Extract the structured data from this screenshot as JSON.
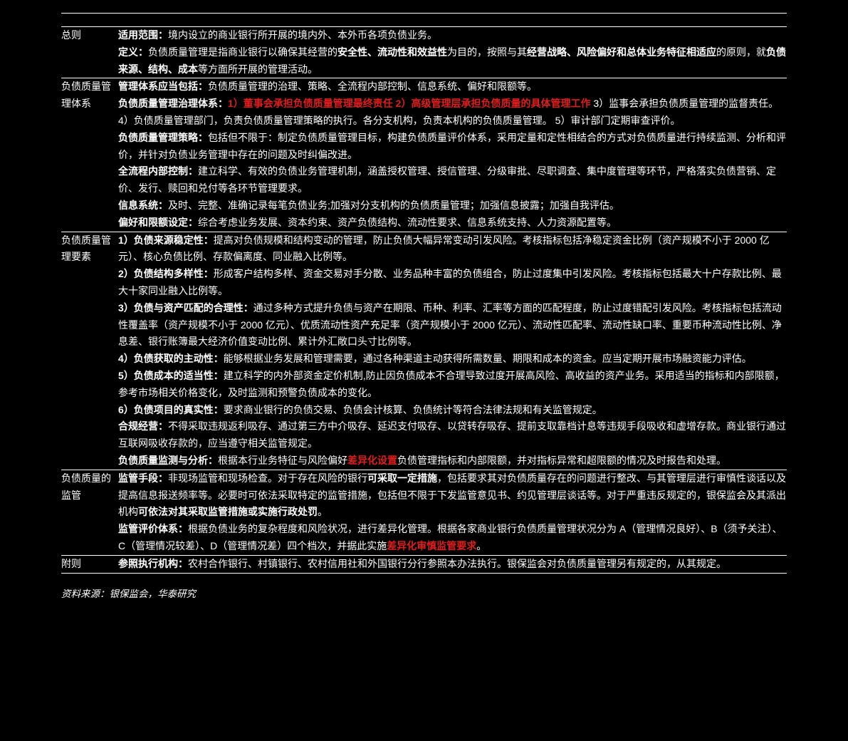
{
  "sections": {
    "general": {
      "label": "总则",
      "scope_prefix_b": "适用范围：",
      "scope_rest": "境内设立的商业银行所开展的境内外、本外币各项负债业务。",
      "def_prefix_b": "定义：",
      "def_p1": "负债质量管理是指商业银行以确保其经营的",
      "def_b1": "安全性、流动性和效益性",
      "def_p2": "为目的，按照与其",
      "def_b2": "经营战略、风险偏好和总体业务特征相适应",
      "def_p3": "的原则，就",
      "def_b3": "负债来源、结构、成本",
      "def_p4": "等方面所开展的管理活动。"
    },
    "system": {
      "label": "负债质量管理体系",
      "t_b": "管理体系应当包括：",
      "t_rest": "负债质量管理的治理、策略、全流程内部控制、信息系统、偏好和限额等。",
      "g_b": "负债质量管理治理体系：",
      "g_red": "1）董事会承担负债质量管理最终责任   2）高级管理层承担负债质量的具体管理工作",
      "g_tail": "  3）监事会承担负债质量管理的监督责任。 4）负债质量管理部门，负责负债质量管理策略的执行。各分支机构，负责本机构的负债质量管理。 5）审计部门定期审查评价。",
      "s_b": "负债质量管理策略：",
      "s_rest": "包括但不限于：制定负债质量管理目标，构建负债质量评价体系，采用定量和定性相结合的方式对负债质量进行持续监测、分析和评价，并针对负债业务管理中存在的问题及时纠偏改进。",
      "ic_b": "全流程内部控制：",
      "ic_rest": "建立科学、有效的负债业务管理机制，涵盖授权管理、授信管理、分级审批、尽职调查、集中度管理等环节，严格落实负债营销、定价、发行、赎回和兑付等各环节管理要求。",
      "is_b": "信息系统：",
      "is_rest": "及时、完整、准确记录每笔负债业务;加强对分支机构的负债质量管理；加强信息披露；加强自我评估。",
      "pl_b": "偏好和限额设定：",
      "pl_rest": "综合考虑业务发展、资本约束、资产负债结构、流动性要求、信息系统支持、人力资源配置等。"
    },
    "elements": {
      "label": "负债质量管理要素",
      "e1_b": "1）负债来源稳定性：",
      "e1_rest": "提高对负债规模和结构变动的管理，防止负债大幅异常变动引发风险。考核指标包括净稳定资金比例（资产规模不小于 2000 亿元）、核心负债比例、存款偏离度、同业融入比例等。",
      "e2_b": "2）负债结构多样性：",
      "e2_rest": "形成客户结构多样、资金交易对手分散、业务品种丰富的负债组合，防止过度集中引发风险。考核指标包括最大十户存款比例、最大十家同业融入比例等。",
      "e3_b": "3）负债与资产匹配的合理性：",
      "e3_rest": "通过多种方式提升负债与资产在期限、币种、利率、汇率等方面的匹配程度，防止过度错配引发风险。考核指标包括流动性覆盖率（资产规模不小于 2000 亿元）、优质流动性资产充足率（资产规模小于 2000 亿元）、流动性匹配率、流动性缺口率、重要币种流动性比例、净息差、银行账簿最大经济价值变动比例、累计外汇敞口头寸比例等。",
      "e4_b": "4）负债获取的主动性：",
      "e4_rest": "能够根据业务发展和管理需要，通过各种渠道主动获得所需数量、期限和成本的资金。应当定期开展市场融资能力评估。",
      "e5_b": "5）负债成本的适当性：",
      "e5_rest": "建立科学的内外部资金定价机制,防止因负债成本不合理导致过度开展高风险、高收益的资产业务。采用适当的指标和内部限额，参考市场相关价格变化，及时监测和预警负债成本的变化。",
      "e6_b": "6）负债项目的真实性：",
      "e6_rest": "要求商业银行的负债交易、负债会计核算、负债统计等符合法律法规和有关监管规定。",
      "c_b": "合规经营：",
      "c_rest": "不得采取违规返利吸存、通过第三方中介吸存、延迟支付吸存、以贷转存吸存、提前支取靠档计息等违规手段吸收和虚增存款。商业银行通过互联网吸收存款的，应当遵守相关监管规定。",
      "m_b": "负债质量监测与分析：",
      "m_p1": "根据本行业务特征与风险偏好",
      "m_red": "差异化设置",
      "m_p2": "负债管理指标和内部限额，并对指标异常和超限额的情况及时报告和处理。"
    },
    "supervision": {
      "label": "负债质量的监管",
      "tools_b": "监管手段：",
      "tools_p1": "非现场监管和现场检查。对于存在风险的银行",
      "tools_b2": "可采取一定措施",
      "tools_p2": "，包括要求其对负债质量存在的问题进行整改、与其管理层进行审慎性谈话以及提高信息报送频率等。必要时可依法采取特定的监管措施，包括但不限于下发监管意见书、约见管理层谈话等。对于严重违反规定的，银保监会及其派出机构",
      "tools_b3": "可依法对其采取监管措施或实施行政处罚",
      "tools_p3": "。",
      "eval_b": "监管评价体系：",
      "eval_p1": "根据负债业务的复杂程度和风险状况，进行差异化管理。根据各家商业银行负债质量管理状况分为 A（管理情况良好）、B（须予关注）、C（管理情况较差）、D（管理情况差）四个档次，并据此实施",
      "eval_redb": "差异化审慎监管要求",
      "eval_p2": "。"
    },
    "appendix": {
      "label": "附则",
      "a_b": "参照执行机构：",
      "a_rest": "农村合作银行、村镇银行、农村信用社和外国银行分行参照本办法执行。银保监会对负债质量管理另有规定的，从其规定。"
    }
  },
  "source": "资料来源：银保监会，华泰研究"
}
